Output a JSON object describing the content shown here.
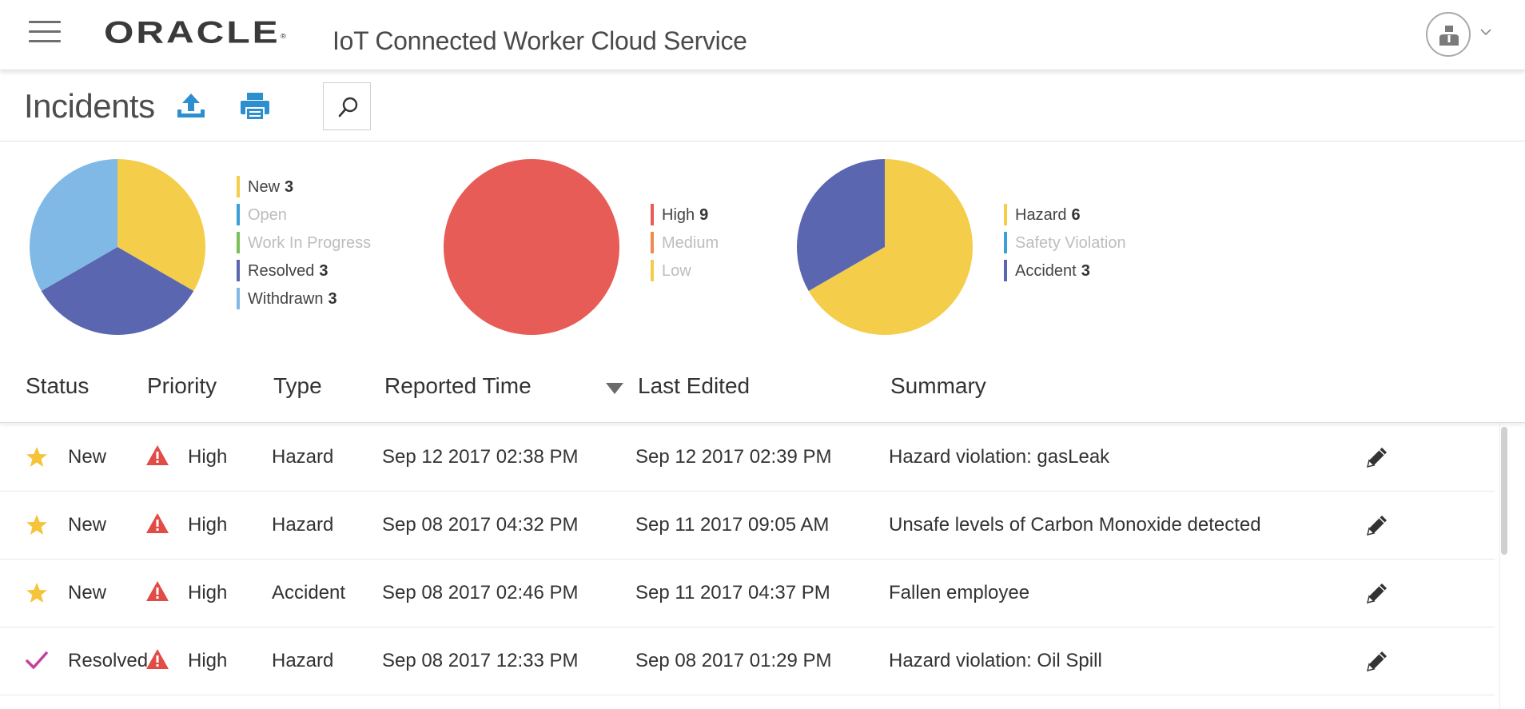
{
  "header": {
    "brand": "ORACLE",
    "brand_mark": "®",
    "app_title": "IoT Connected Worker Cloud Service"
  },
  "toolbar": {
    "page_title": "Incidents"
  },
  "charts": [
    {
      "name": "status",
      "legend": [
        {
          "label": "New",
          "count": "3",
          "color": "#f4cd4a",
          "active": true
        },
        {
          "label": "Open",
          "count": "",
          "color": "#3c9fd8",
          "active": false
        },
        {
          "label": "Work In Progress",
          "count": "",
          "color": "#7bbf5a",
          "active": false
        },
        {
          "label": "Resolved",
          "count": "3",
          "color": "#5a67b0",
          "active": true
        },
        {
          "label": "Withdrawn",
          "count": "3",
          "color": "#80b9e6",
          "active": true
        }
      ]
    },
    {
      "name": "priority",
      "legend": [
        {
          "label": "High",
          "count": "9",
          "color": "#e85c57",
          "active": true
        },
        {
          "label": "Medium",
          "count": "",
          "color": "#f08a4b",
          "active": false
        },
        {
          "label": "Low",
          "count": "",
          "color": "#f4cd4a",
          "active": false
        }
      ]
    },
    {
      "name": "type",
      "legend": [
        {
          "label": "Hazard",
          "count": "6",
          "color": "#f4cd4a",
          "active": true
        },
        {
          "label": "Safety Violation",
          "count": "",
          "color": "#3c9fd8",
          "active": false
        },
        {
          "label": "Accident",
          "count": "3",
          "color": "#5a67b0",
          "active": true
        }
      ]
    }
  ],
  "chart_data": [
    {
      "type": "pie",
      "categories": [
        "New",
        "Resolved",
        "Withdrawn"
      ],
      "values": [
        3,
        3,
        3
      ],
      "colors": [
        "#f4cd4a",
        "#5a67b0",
        "#80b9e6"
      ]
    },
    {
      "type": "pie",
      "categories": [
        "High"
      ],
      "values": [
        9
      ],
      "colors": [
        "#e85c57"
      ]
    },
    {
      "type": "pie",
      "categories": [
        "Hazard",
        "Accident"
      ],
      "values": [
        6,
        3
      ],
      "colors": [
        "#f4cd4a",
        "#5a67b0"
      ]
    }
  ],
  "table": {
    "columns": [
      "Status",
      "Priority",
      "Type",
      "Reported Time",
      "Last Edited",
      "Summary"
    ],
    "rows": [
      {
        "status": "New",
        "status_icon": "star-icon",
        "priority": "High",
        "type": "Hazard",
        "reported": "Sep 12 2017 02:38 PM",
        "edited": "Sep 12 2017 02:39 PM",
        "summary": "Hazard violation: gasLeak"
      },
      {
        "status": "New",
        "status_icon": "star-icon",
        "priority": "High",
        "type": "Hazard",
        "reported": "Sep 08 2017 04:32 PM",
        "edited": "Sep 11 2017 09:05 AM",
        "summary": "Unsafe levels of Carbon Monoxide detected"
      },
      {
        "status": "New",
        "status_icon": "star-icon",
        "priority": "High",
        "type": "Accident",
        "reported": "Sep 08 2017 02:46 PM",
        "edited": "Sep 11 2017 04:37 PM",
        "summary": "Fallen employee"
      },
      {
        "status": "Resolved",
        "status_icon": "checkmark-icon",
        "priority": "High",
        "type": "Hazard",
        "reported": "Sep 08 2017 12:33 PM",
        "edited": "Sep 08 2017 01:29 PM",
        "summary": "Hazard violation: Oil Spill"
      }
    ]
  }
}
